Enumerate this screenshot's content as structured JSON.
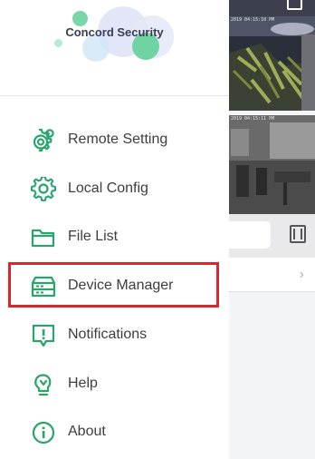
{
  "brand": {
    "name": "Concord Security"
  },
  "menu": {
    "items": [
      {
        "label": "Remote Setting",
        "icon": "gears-icon"
      },
      {
        "label": "Local Config",
        "icon": "gear-icon"
      },
      {
        "label": "File List",
        "icon": "folder-icon"
      },
      {
        "label": "Device Manager",
        "icon": "device-manager-icon"
      },
      {
        "label": "Notifications",
        "icon": "notification-icon"
      },
      {
        "label": "Help",
        "icon": "help-bulb-icon"
      },
      {
        "label": "About",
        "icon": "info-icon"
      }
    ]
  },
  "background": {
    "camera_1_timestamp": "2019 04:15:10 PM",
    "camera_2_timestamp": "2019 04:15:11 PM"
  },
  "colors": {
    "accent": "#27a56b",
    "highlight": "#e0242f"
  }
}
